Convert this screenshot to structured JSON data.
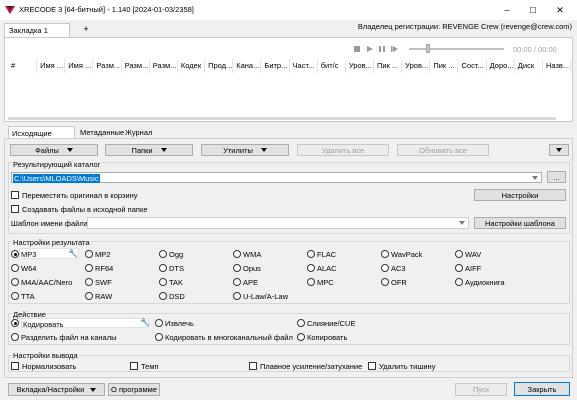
{
  "window": {
    "title": "XRECODE 3 [64-битный] - 1.140 [2024-01-03/2358]",
    "minimize": "─",
    "maximize": "☐",
    "close": "✕"
  },
  "owner_text": "Владелец регистрации: REVENGE Crew (revenge@crew.com)",
  "top_tabs": {
    "active": "Закладка 1",
    "add": "+"
  },
  "player": {
    "time": "00:00 / 00:00"
  },
  "columns": [
    "#",
    "Имя ...",
    "Имя ...",
    "Разм...",
    "Разм...",
    "Разм...",
    "Кодек",
    "Прод...",
    "Кана...",
    "Битр...",
    "Част...",
    "бит/с",
    "Уров...",
    "Пик ...",
    "Уров...",
    "Пик ...",
    "Сост...",
    "Доро...",
    "Диск",
    "Назв..."
  ],
  "bottom_tabs": [
    "Исходящие Файлы",
    "Метаданные",
    "Журнал"
  ],
  "toolbar": {
    "files": "Файлы",
    "folders": "Папки",
    "utilities": "Утилиты",
    "remove_all": "Удалить все",
    "refresh_all": "Обновить все"
  },
  "output_dir": {
    "label": "Результирующий каталог",
    "path": "C:\\Users\\MLOADS\\Music",
    "browse": "...",
    "move_to_trash": "Переместить оригинал в корзину",
    "settings": "Настройки",
    "create_in_source": "Создавать файлы в исходной папке",
    "filename_template_label": "Шаблон имени файла",
    "template_settings": "Настройки шаблона"
  },
  "result_settings": {
    "label": "Настройки результата",
    "formats": [
      [
        "MP3",
        "MP2",
        "Ogg",
        "WMA",
        "FLAC",
        "WavPack",
        "WAV"
      ],
      [
        "W64",
        "RF64",
        "DTS",
        "Opus",
        "ALAC",
        "AC3",
        "AIFF"
      ],
      [
        "M4A/AAC/Nero",
        "SWF",
        "TAK",
        "APE",
        "MPC",
        "OFR",
        "Аудиокнига"
      ],
      [
        "TTA",
        "RAW",
        "DSD",
        "U-Law/A-Law"
      ]
    ],
    "selected": "MP3"
  },
  "action": {
    "label": "Действие",
    "encode": "Кодировать",
    "extract": "Извлечь",
    "merge": "Слияние/CUE",
    "split": "Разделить файл на каналы",
    "multichannel": "Кодировать в многоканальный файл",
    "copy": "Копировать"
  },
  "output_settings": {
    "label": "Настройки вывода",
    "normalize": "Нормализовать",
    "tempo": "Темп",
    "fade": "Плавное усиление/затухание",
    "remove_silence": "Удалить тишину"
  },
  "footer": {
    "tab_settings": "Вкладка/Настройки",
    "about": "О программе",
    "start": "Пуск",
    "close": "Закрыть"
  },
  "colors": {
    "accent": "#0078d7",
    "logo": "#c8102e"
  }
}
